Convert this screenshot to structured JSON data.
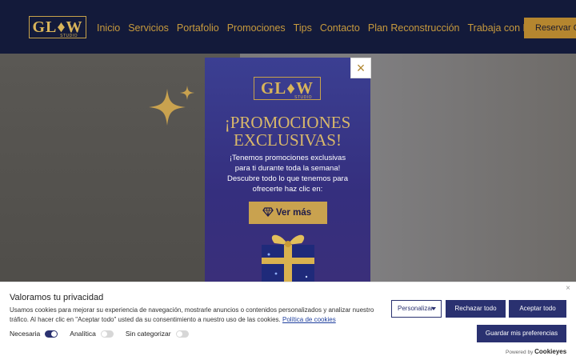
{
  "header": {
    "logo_text": "GL♦W",
    "logo_sub": "STUDIO",
    "nav": [
      "Inicio",
      "Servicios",
      "Portafolio",
      "Promociones",
      "Tips",
      "Contacto",
      "Plan Reconstrucción",
      "Trabaja con Nosotros"
    ],
    "book_button": "Reservar Cita"
  },
  "popup": {
    "logo_text": "GL♦W",
    "logo_sub": "STUDIO",
    "title_line1": "¡PROMOCIONES",
    "title_line2": "EXCLUSIVAS!",
    "body": "¡Tenemos promociones exclusivas para ti durante toda la semana! Descubre todo lo que tenemos para ofrecerte haz clic en:",
    "cta": "Ver más",
    "close": "×"
  },
  "cookie": {
    "title": "Valoramos tu privacidad",
    "text": "Usamos cookies para mejorar su experiencia de navegación, mostrarle anuncios o contenidos personalizados y analizar nuestro tráfico. Al hacer clic en \"Aceptar todo\" usted da su consentimiento a nuestro uso de las cookies.",
    "link": "Política de cookies",
    "toggles": [
      {
        "label": "Necesaria",
        "state": "on"
      },
      {
        "label": "Analítica",
        "state": "off"
      },
      {
        "label": "Sin categorizar",
        "state": "off"
      }
    ],
    "customize": "Personalizar",
    "reject": "Rechazar todo",
    "accept": "Aceptar todo",
    "save": "Guardar mis preferencias",
    "powered_by": "Powered by",
    "brand": "Cookieyes",
    "close": "×"
  },
  "colors": {
    "navy": "#131a3a",
    "gold": "#c9a24f",
    "popup_purple": "#3b3f92",
    "button_dark": "#2a3170"
  }
}
